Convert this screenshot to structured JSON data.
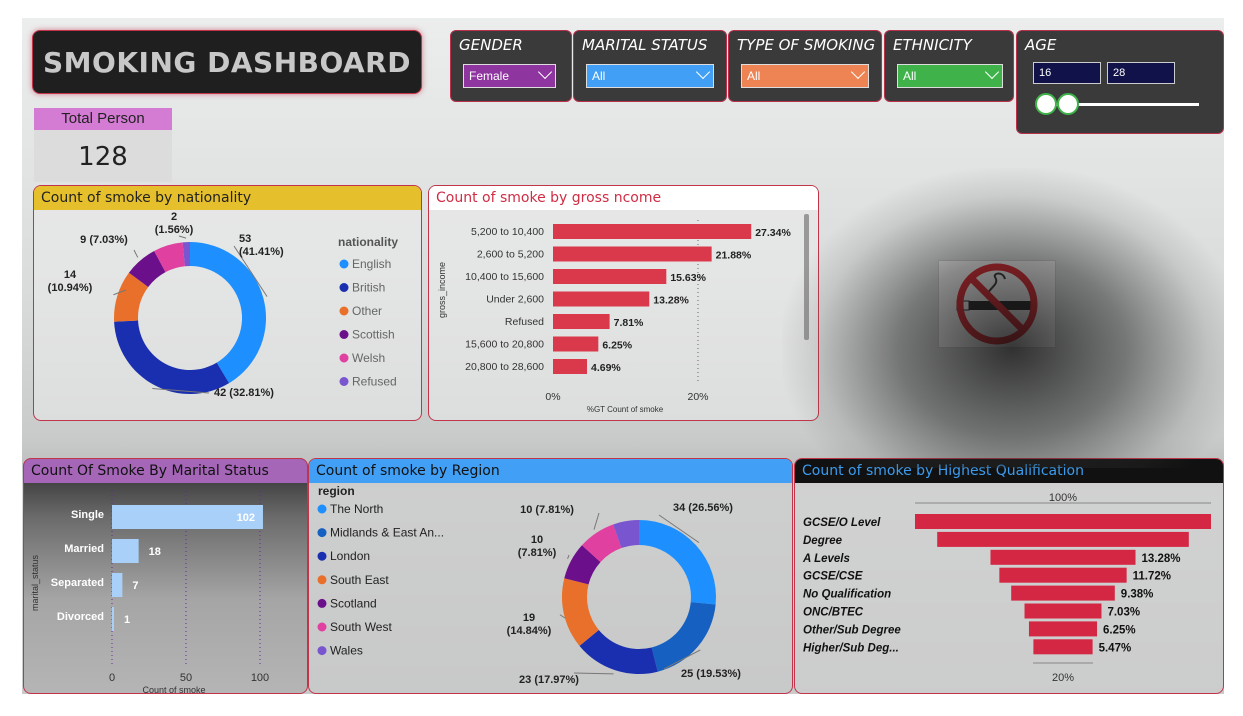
{
  "dashboard": {
    "title": "SMOKING DASHBOARD"
  },
  "slicers": {
    "gender": {
      "label": "GENDER",
      "value": "Female",
      "color": "#8e35a0"
    },
    "marital": {
      "label": "MARITAL STATUS",
      "value": "All",
      "color": "#41a0f5"
    },
    "smoking": {
      "label": "TYPE OF SMOKING",
      "value": "All",
      "color": "#ee8454"
    },
    "ethnicity": {
      "label": "ETHNICITY",
      "value": "All",
      "color": "#3fb34a"
    },
    "age": {
      "label": "AGE",
      "min": "16",
      "max": "28",
      "selected_fraction_low": 0.0,
      "selected_fraction_high": 0.15
    }
  },
  "total": {
    "label": "Total Person",
    "value": "128"
  },
  "icons": {
    "no_smoking": "no-smoking-sign-icon"
  },
  "chart_data": [
    {
      "type": "pie",
      "title": "Count of smoke by nationality",
      "legend_title": "nationality",
      "categories": [
        "English",
        "British",
        "Other",
        "Scottish",
        "Welsh",
        "Refused"
      ],
      "values": [
        53,
        42,
        14,
        9,
        8,
        2
      ],
      "labels": [
        "53\n(41.41%)",
        "42 (32.81%)",
        "14\n(10.94%)",
        "9 (7.03%)",
        "",
        "2\n(1.56%)"
      ],
      "colors": [
        "#1e8fff",
        "#1a2fb0",
        "#e8702a",
        "#6b0f8a",
        "#e040a0",
        "#7a55d0"
      ],
      "legend_position": "right"
    },
    {
      "type": "bar",
      "orientation": "horizontal",
      "title": "Count of smoke by gross ncome",
      "ylabel": "gross_income",
      "xlabel": "%GT Count of smoke",
      "categories": [
        "5,200 to 10,400",
        "2,600 to 5,200",
        "10,400 to 15,600",
        "Under 2,600",
        "Refused",
        "15,600 to 20,800",
        "20,800 to 28,600"
      ],
      "values": [
        27.34,
        21.88,
        15.63,
        13.28,
        7.81,
        6.25,
        4.69
      ],
      "value_labels": [
        "27.34%",
        "21.88%",
        "15.63%",
        "13.28%",
        "7.81%",
        "6.25%",
        "4.69%"
      ],
      "x_ticks": [
        "0%",
        "20%"
      ],
      "xlim": [
        0,
        32
      ],
      "color": "#d9394b"
    },
    {
      "type": "bar",
      "orientation": "horizontal",
      "title": "Count Of Smoke By Marital Status",
      "ylabel": "marital_status",
      "xlabel": "Count of smoke",
      "categories": [
        "Single",
        "Married",
        "Separated",
        "Divorced"
      ],
      "values": [
        102,
        18,
        7,
        1
      ],
      "x_ticks": [
        "0",
        "50",
        "100"
      ],
      "xlim": [
        0,
        120
      ],
      "color": "#a9d0f8"
    },
    {
      "type": "pie",
      "title": "Count of smoke by Region",
      "legend_title": "region",
      "categories": [
        "The North",
        "Midlands & East An...",
        "London",
        "South East",
        "Scotland",
        "South West",
        "Wales"
      ],
      "values": [
        34,
        25,
        23,
        19,
        10,
        10,
        7
      ],
      "labels": [
        "34 (26.56%)",
        "25 (19.53%)",
        "23 (17.97%)",
        "19\n(14.84%)",
        "10\n(7.81%)",
        "10 (7.81%)",
        ""
      ],
      "colors": [
        "#1e8fff",
        "#1560c0",
        "#1a2fb0",
        "#e8702a",
        "#6b0f8a",
        "#e040a0",
        "#7a55d0"
      ],
      "legend_position": "left"
    },
    {
      "type": "bar",
      "orientation": "funnel",
      "title": "Count of smoke by Highest Qualification",
      "categories": [
        "GCSE/O Level",
        "Degree",
        "A Levels",
        "GCSE/CSE",
        "No Qualification",
        "ONC/BTEC",
        "Other/Sub Degree",
        "Higher/Sub Deg..."
      ],
      "values": [
        100,
        75,
        13.28,
        11.72,
        9.38,
        7.03,
        6.25,
        5.47
      ],
      "value_labels": [
        "",
        "",
        "13.28%",
        "11.72%",
        "9.38%",
        "7.03%",
        "6.25%",
        "5.47%"
      ],
      "top_label": "100%",
      "bottom_label": "20%",
      "color": "#d42744"
    }
  ]
}
